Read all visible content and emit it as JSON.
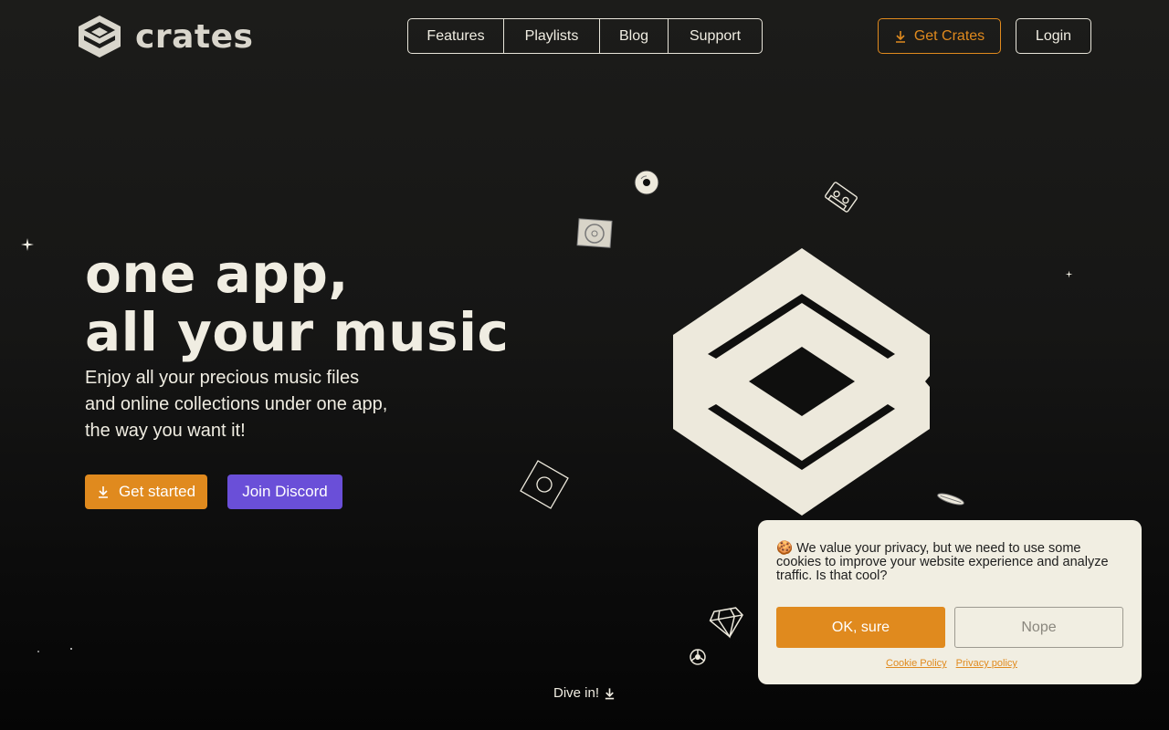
{
  "brand": {
    "name": "crates",
    "logo_icon": "crates-logo-icon"
  },
  "nav": {
    "items": [
      {
        "label": "Features"
      },
      {
        "label": "Playlists"
      },
      {
        "label": "Blog"
      },
      {
        "label": "Support"
      }
    ]
  },
  "header_actions": {
    "get_crates_label": "Get Crates",
    "get_crates_icon": "download-icon",
    "login_label": "Login"
  },
  "hero": {
    "title_line1": "one app,",
    "title_line2": "all your music",
    "subtitle_line1": "Enjoy all your precious music files",
    "subtitle_line2": "and online collections under one app,",
    "subtitle_line3": "the way you want it!",
    "primary_cta": "Get started",
    "secondary_cta": "Join Discord"
  },
  "dive": {
    "label": "Dive in!",
    "icon": "download-arrow-icon"
  },
  "cookie_banner": {
    "emoji": "🍪",
    "text": "We value your privacy, but we need to use some cookies to improve your website experience and analyze traffic. Is that cool?",
    "accept_label": "OK, sure",
    "decline_label": "Nope",
    "cookie_policy_link": "Cookie Policy",
    "privacy_policy_link": "Privacy policy"
  },
  "colors": {
    "accent": "#e08a1e",
    "discord": "#6a4fd8",
    "foreground": "#f0ede2",
    "cookie_bg": "#f1eee2"
  }
}
